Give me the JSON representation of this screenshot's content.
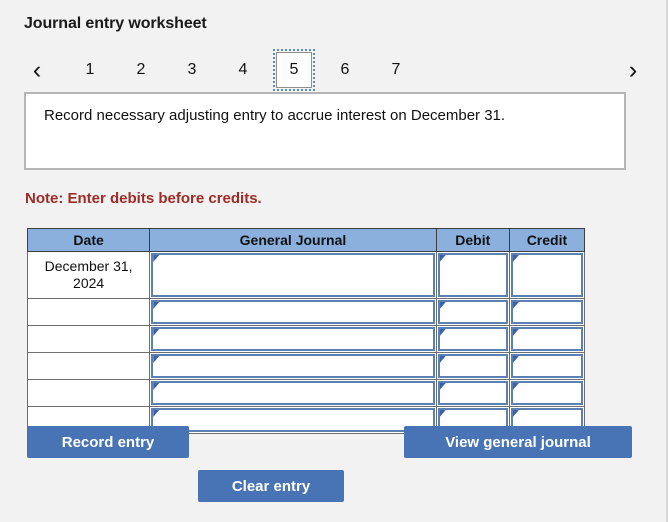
{
  "page": {
    "title": "Journal entry worksheet",
    "background_color": "#f2f2f2"
  },
  "pager": {
    "prev_label": "‹",
    "next_label": "›",
    "prev_name": "chevron-left-icon",
    "next_name": "chevron-right-icon",
    "active_tab": "5",
    "tabs": [
      {
        "label": "1",
        "active": false
      },
      {
        "label": "2",
        "active": false
      },
      {
        "label": "3",
        "active": false
      },
      {
        "label": "4",
        "active": false
      },
      {
        "label": "5",
        "active": true
      },
      {
        "label": "6",
        "active": false
      },
      {
        "label": "7",
        "active": false
      }
    ]
  },
  "instruction": {
    "text": "Record necessary adjusting entry to accrue interest on December 31."
  },
  "note": {
    "text": "Note: Enter debits before credits.",
    "color": "#9e2b25"
  },
  "table": {
    "header_color": "#8cb0dd",
    "columns": [
      {
        "key": "date",
        "label": "Date"
      },
      {
        "key": "journal",
        "label": "General Journal"
      },
      {
        "key": "debit",
        "label": "Debit"
      },
      {
        "key": "credit",
        "label": "Credit"
      }
    ],
    "rows": [
      {
        "date": "December 31, 2024",
        "journal": "",
        "debit": "",
        "credit": ""
      },
      {
        "date": "",
        "journal": "",
        "debit": "",
        "credit": ""
      },
      {
        "date": "",
        "journal": "",
        "debit": "",
        "credit": ""
      },
      {
        "date": "",
        "journal": "",
        "debit": "",
        "credit": ""
      },
      {
        "date": "",
        "journal": "",
        "debit": "",
        "credit": ""
      },
      {
        "date": "",
        "journal": "",
        "debit": "",
        "credit": ""
      }
    ]
  },
  "buttons": {
    "accent_color": "#4873b4",
    "record_entry": "Record entry",
    "view_general_journal": "View general journal",
    "clear_entry": "Clear entry"
  }
}
